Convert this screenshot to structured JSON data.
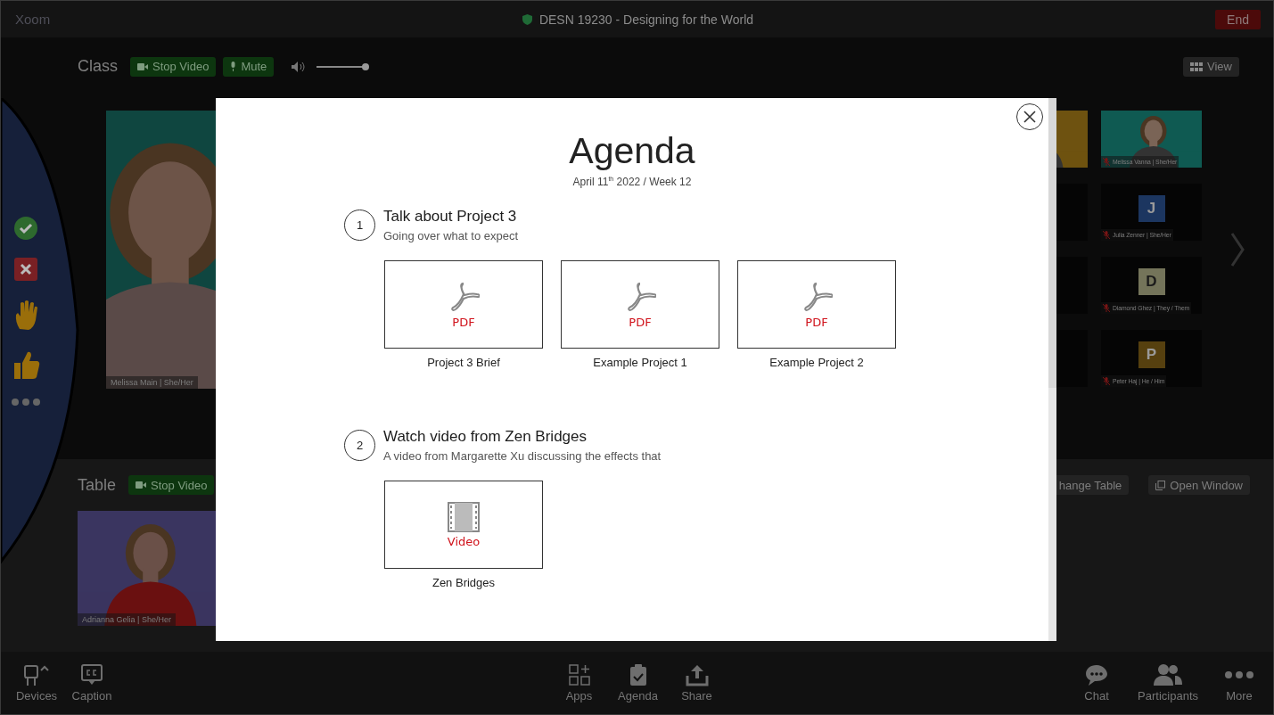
{
  "top_bar": {
    "app_name": "Xoom",
    "meeting_title": "DESN 19230 - Designing for the World",
    "end_label": "End"
  },
  "class_section": {
    "title": "Class",
    "buttons": [
      {
        "label": "Stop Video",
        "kind": "video"
      },
      {
        "label": "Mute",
        "kind": "mic"
      }
    ],
    "volume": {
      "level": 0.95
    },
    "view_label": "View",
    "main_tile": {
      "label": "Melissa Main | She/Her"
    },
    "tiles": [
      {
        "kind": "picture",
        "color": "#6e5210"
      },
      {
        "kind": "picture",
        "color": "#0f5a52",
        "label": "Melissa Vanna | She/Her",
        "muted": true
      },
      {
        "kind": "blank"
      },
      {
        "kind": "avatar",
        "initial": "J",
        "color": "#1c3660",
        "label": "Julia Zenner | She/Her",
        "muted": true
      },
      {
        "kind": "blank"
      },
      {
        "kind": "avatar",
        "initial": "D",
        "color": "#74745a",
        "label": "Diamond Ghez | They / Them",
        "muted": true
      },
      {
        "kind": "blank"
      },
      {
        "kind": "avatar",
        "initial": "P",
        "color": "#56400f",
        "label": "Peter Haj | He / Him",
        "muted": true
      }
    ]
  },
  "reactions": [
    {
      "kind": "check"
    },
    {
      "kind": "cross"
    },
    {
      "kind": "hand"
    },
    {
      "kind": "thumb"
    },
    {
      "kind": "more"
    }
  ],
  "table_section": {
    "title": "Table",
    "buttons": [
      {
        "label": "Stop Video",
        "kind": "video"
      }
    ],
    "right_buttons": [
      {
        "label": "hange Table",
        "kind": "plain"
      },
      {
        "label": "Open Window",
        "kind": "window"
      }
    ],
    "tile": {
      "label": "Adrianna Gelia | She/Her"
    }
  },
  "agenda_modal": {
    "title": "Agenda",
    "date": "April 11$^{th}$ 2022 / Week 12",
    "items": [
      {
        "number": "1",
        "title": "Talk about Project 3",
        "subtitle": "Going over what to expect",
        "attachments": [
          {
            "kind": "pdf",
            "label": "PDF",
            "caption": "Project 3 Brief"
          },
          {
            "kind": "pdf",
            "label": "PDF",
            "caption": "Example Project 1"
          },
          {
            "kind": "pdf",
            "label": "PDF",
            "caption": "Example Project 2"
          }
        ]
      },
      {
        "number": "2",
        "title": "Watch video from Zen Bridges",
        "subtitle": "A video from Margarette Xu discussing the effects that",
        "attachments": [
          {
            "kind": "video",
            "label": "Video",
            "caption": "Zen Bridges"
          }
        ]
      }
    ]
  },
  "toolbar": {
    "left": [
      {
        "kind": "devices",
        "label": "Devices"
      },
      {
        "kind": "caption",
        "label": "Caption"
      }
    ],
    "center": [
      {
        "kind": "apps",
        "label": "Apps"
      },
      {
        "kind": "agenda",
        "label": "Agenda"
      },
      {
        "kind": "share",
        "label": "Share"
      }
    ],
    "right": [
      {
        "kind": "chat",
        "label": "Chat"
      },
      {
        "kind": "participants",
        "label": "Participants"
      },
      {
        "kind": "more",
        "label": "More"
      }
    ]
  }
}
